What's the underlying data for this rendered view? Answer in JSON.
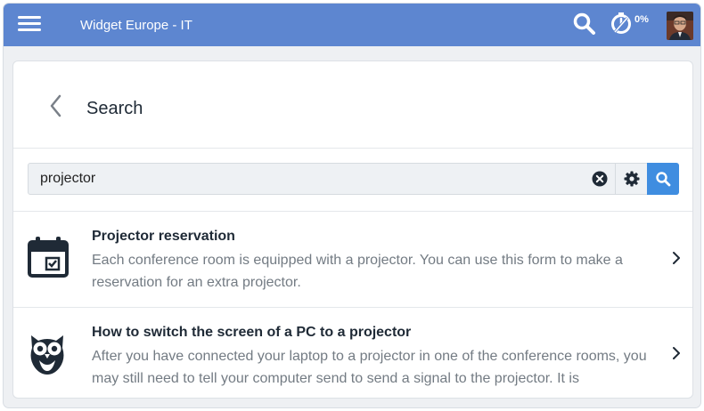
{
  "topbar": {
    "app_title": "Widget Europe - IT",
    "timer_percent": "0%",
    "icons": [
      "hamburger-menu-icon",
      "search-icon",
      "timer-icon",
      "avatar"
    ],
    "color": "#5d86d0"
  },
  "page": {
    "title": "Search",
    "back_icon": "chevron-left-icon"
  },
  "search": {
    "value": "projector",
    "icons": [
      "clear-icon",
      "gear-icon",
      "search-icon"
    ],
    "button_color": "#3f8de0"
  },
  "results": [
    {
      "icon": "calendar-icon",
      "title": "Projector reservation",
      "snippet": "Each conference room is equipped with a projector. You can use this form to make a reservation for an extra projector."
    },
    {
      "icon": "owl-icon",
      "title": "How to switch the screen of a PC to a projector",
      "snippet": "After you have connected your laptop to a projector in one of the conference rooms, you may still need to tell your computer send to send a signal to the projector. It is"
    }
  ]
}
